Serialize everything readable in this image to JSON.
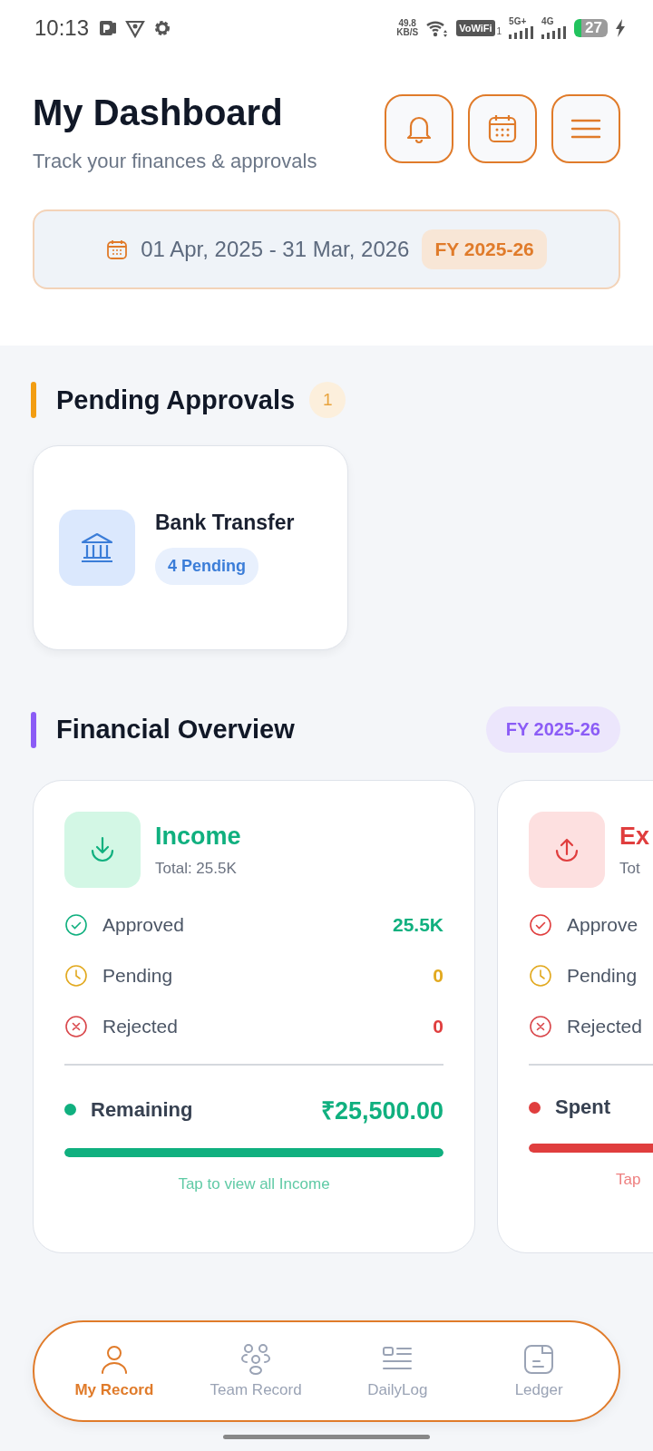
{
  "status_bar": {
    "time": "10:13",
    "speed_value": "49.8",
    "speed_unit": "KB/S",
    "vowifi": "VoWiFi",
    "sim_index": "1",
    "network_1": "5G+",
    "network_2": "4G",
    "battery": "27"
  },
  "header": {
    "title": "My Dashboard",
    "subtitle": "Track your finances & approvals",
    "date_range": "01 Apr, 2025 - 31 Mar, 2026",
    "fy_badge": "FY 2025-26"
  },
  "pending_approvals": {
    "title": "Pending Approvals",
    "count": "1",
    "items": [
      {
        "name": "Bank Transfer",
        "badge": "4 Pending"
      }
    ]
  },
  "financial_overview": {
    "title": "Financial Overview",
    "fy_badge": "FY 2025-26",
    "cards": [
      {
        "kind": "income",
        "title": "Income",
        "total": "Total: 25.5K",
        "rows": [
          {
            "kind": "approved",
            "label": "Approved",
            "value": "25.5K"
          },
          {
            "kind": "pending",
            "label": "Pending",
            "value": "0"
          },
          {
            "kind": "rejected",
            "label": "Rejected",
            "value": "0"
          }
        ],
        "summary_label": "Remaining",
        "summary_value": "₹25,500.00",
        "level": 1,
        "link": "Tap to view all Income"
      },
      {
        "kind": "expense",
        "title": "Ex",
        "total": "Tot",
        "rows": [
          {
            "kind": "approved",
            "label": "Approve"
          },
          {
            "kind": "pending",
            "label": "Pending"
          },
          {
            "kind": "rejected",
            "label": "Rejected"
          }
        ],
        "summary_label": "Spent",
        "level": 1,
        "link": "Tap"
      }
    ]
  },
  "bottom_nav": [
    {
      "label": "My Record",
      "kind": "person",
      "selected": true
    },
    {
      "label": "Team Record",
      "kind": "team",
      "selected": false
    },
    {
      "label": "DailyLog",
      "kind": "log",
      "selected": false
    },
    {
      "label": "Ledger",
      "kind": "ledger",
      "selected": false
    }
  ]
}
